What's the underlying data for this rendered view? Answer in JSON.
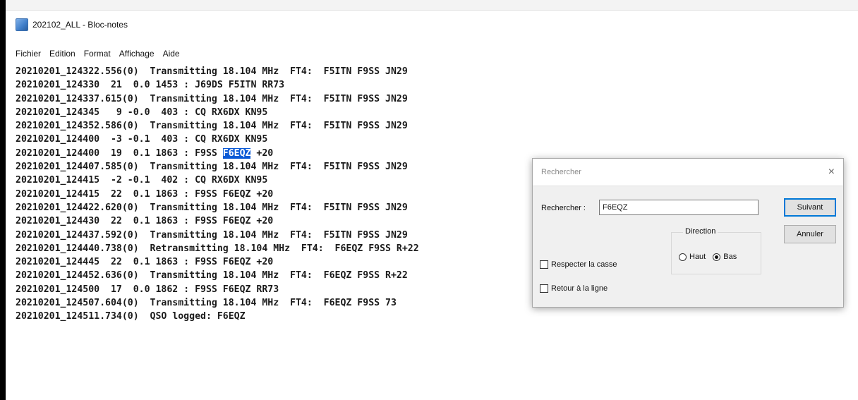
{
  "window": {
    "title": "202102_ALL - Bloc-notes",
    "icon": "notepad-icon"
  },
  "menu": [
    "Fichier",
    "Edition",
    "Format",
    "Affichage",
    "Aide"
  ],
  "editor": {
    "highlight": {
      "line": 6,
      "text": "F6EQZ"
    },
    "lines": [
      "20210201_124322.556(0)  Transmitting 18.104 MHz  FT4:  F5ITN F9SS JN29",
      "20210201_124330  21  0.0 1453 : J69DS F5ITN RR73",
      "20210201_124337.615(0)  Transmitting 18.104 MHz  FT4:  F5ITN F9SS JN29",
      "20210201_124345   9 -0.0  403 : CQ RX6DX KN95",
      "20210201_124352.586(0)  Transmitting 18.104 MHz  FT4:  F5ITN F9SS JN29",
      "20210201_124400  -3 -0.1  403 : CQ RX6DX KN95",
      "20210201_124400  19  0.1 1863 : F9SS F6EQZ +20",
      "20210201_124407.585(0)  Transmitting 18.104 MHz  FT4:  F5ITN F9SS JN29",
      "20210201_124415  -2 -0.1  402 : CQ RX6DX KN95",
      "20210201_124415  22  0.1 1863 : F9SS F6EQZ +20",
      "20210201_124422.620(0)  Transmitting 18.104 MHz  FT4:  F5ITN F9SS JN29",
      "20210201_124430  22  0.1 1863 : F9SS F6EQZ +20",
      "20210201_124437.592(0)  Transmitting 18.104 MHz  FT4:  F5ITN F9SS JN29",
      "20210201_124440.738(0)  Retransmitting 18.104 MHz  FT4:  F6EQZ F9SS R+22",
      "20210201_124445  22  0.1 1863 : F9SS F6EQZ +20",
      "20210201_124452.636(0)  Transmitting 18.104 MHz  FT4:  F6EQZ F9SS R+22",
      "20210201_124500  17  0.0 1862 : F9SS F6EQZ RR73",
      "20210201_124507.604(0)  Transmitting 18.104 MHz  FT4:  F6EQZ F9SS 73",
      "20210201_124511.734(0)  QSO logged: F6EQZ"
    ]
  },
  "dialog": {
    "title": "Rechercher",
    "close_label": "×",
    "search_label": "Rechercher :",
    "search_value": "F6EQZ",
    "next_button": "Suivant",
    "cancel_button": "Annuler",
    "direction_label": "Direction",
    "up_label": "Haut",
    "down_label": "Bas",
    "direction_selected": "Bas",
    "match_case_label": "Respecter la casse",
    "wrap_label": "Retour à la ligne"
  }
}
